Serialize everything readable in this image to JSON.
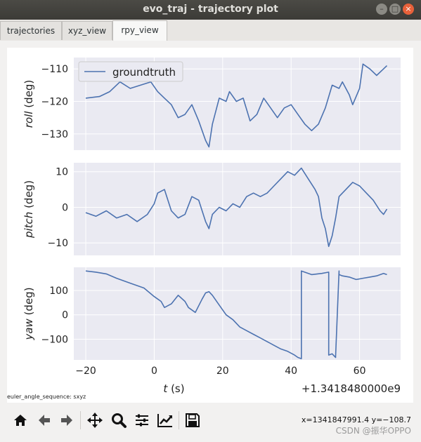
{
  "window": {
    "title": "evo_traj - trajectory plot"
  },
  "tabs": [
    {
      "label": "trajectories"
    },
    {
      "label": "xyz_view"
    },
    {
      "label": "rpy_view"
    }
  ],
  "active_tab": "rpy_view",
  "figure": {
    "footnote": "euler_angle_sequence: sxyz",
    "x_offset_text": "+1.3418480000e9"
  },
  "statusbar": {
    "coords": "x=1341847991.4 y=−108.7",
    "watermark": "CSDN @振华OPPO"
  },
  "toolbar": {
    "icons": [
      "home-icon",
      "back-icon",
      "forward-icon",
      "pan-icon",
      "zoom-icon",
      "configure-subplots-icon",
      "edit-axis-icon",
      "save-icon"
    ]
  },
  "colors": {
    "line": "#4c72b0",
    "axes_bg": "#eaeaf2",
    "grid": "#ffffff"
  },
  "chart_data": [
    {
      "type": "line",
      "ylabel_italic": "roll",
      "ylabel_unit": " (deg)",
      "xlabel": "",
      "legend": {
        "entries": [
          "groundtruth"
        ],
        "placement": "top-left"
      },
      "ylim": [
        -135,
        -106.5
      ],
      "yticks": [
        -130,
        -120,
        -110
      ],
      "ytick_labels": [
        "−130",
        "−120",
        "−110"
      ],
      "xlim": [
        -23.5,
        72
      ],
      "xticks": [
        -20,
        0,
        20,
        40,
        60
      ],
      "grid": true,
      "series": [
        {
          "name": "groundtruth",
          "x": [
            -20,
            -16,
            -13,
            -10,
            -7,
            -4,
            -1,
            1,
            3,
            5,
            7,
            9,
            11,
            13,
            15,
            16,
            17,
            19,
            21,
            22,
            24,
            26,
            28,
            30,
            32,
            34,
            36,
            38,
            40,
            42,
            44,
            46,
            48,
            50,
            52,
            54,
            55,
            57,
            58,
            60,
            61,
            63,
            65,
            67,
            68
          ],
          "y": [
            -119,
            -118.5,
            -117,
            -114,
            -116,
            -115,
            -114,
            -117,
            -119,
            -121,
            -125,
            -124,
            -121,
            -126,
            -132,
            -134,
            -127,
            -119,
            -120,
            -117,
            -120,
            -119,
            -126,
            -124,
            -119,
            -122,
            -125,
            -122,
            -121,
            -124,
            -127,
            -129,
            -127,
            -122,
            -115,
            -116,
            -114,
            -118,
            -121,
            -116,
            -108.5,
            -110,
            -112,
            -110,
            -109
          ]
        }
      ]
    },
    {
      "type": "line",
      "ylabel_italic": "pitch",
      "ylabel_unit": " (deg)",
      "xlabel": "",
      "ylim": [
        -13.5,
        12.5
      ],
      "yticks": [
        -10,
        0,
        10
      ],
      "ytick_labels": [
        "−10",
        "0",
        "10"
      ],
      "xlim": [
        -23.5,
        72
      ],
      "xticks": [
        -20,
        0,
        20,
        40,
        60
      ],
      "grid": true,
      "series": [
        {
          "name": "groundtruth",
          "x": [
            -20,
            -17,
            -14,
            -11,
            -8,
            -5,
            -2,
            0,
            1,
            3,
            5,
            7,
            9,
            11,
            13,
            15,
            16,
            17,
            19,
            21,
            23,
            25,
            27,
            29,
            31,
            33,
            35,
            37,
            39,
            41,
            43,
            45,
            47,
            48,
            49,
            50,
            51,
            52,
            53,
            54,
            56,
            58,
            60,
            62,
            64,
            66,
            67,
            68
          ],
          "y": [
            -1.5,
            -2.5,
            -1,
            -3,
            -2,
            -4,
            -2,
            1,
            4,
            5,
            -1,
            -3,
            -2,
            3,
            2,
            -4,
            -6,
            -2,
            0,
            -1,
            1,
            0,
            3,
            4,
            3,
            4,
            6,
            8,
            10,
            9,
            11,
            8,
            5,
            3,
            -3,
            -6,
            -11,
            -8,
            -3,
            3,
            5,
            7,
            6,
            4,
            2,
            -1,
            -2,
            -0.5
          ]
        }
      ]
    },
    {
      "type": "line",
      "ylabel_italic": "yaw",
      "ylabel_unit": " (deg)",
      "xlabel": "t (s)",
      "ylim": [
        -185,
        195
      ],
      "yticks": [
        -100,
        0,
        100
      ],
      "ytick_labels": [
        "−100",
        "0",
        "100"
      ],
      "xlim": [
        -23.5,
        72
      ],
      "xticks": [
        -20,
        0,
        20,
        40,
        60
      ],
      "xtick_labels": [
        "−20",
        "0",
        "20",
        "40",
        "60"
      ],
      "grid": true,
      "series": [
        {
          "name": "groundtruth",
          "x": [
            -20,
            -17,
            -14,
            -11,
            -7,
            -3,
            0,
            2,
            3,
            5,
            7,
            9,
            10,
            12,
            14,
            15,
            16,
            17,
            19,
            21,
            23,
            25,
            27,
            29,
            31,
            33,
            35,
            37,
            39,
            41,
            42,
            43,
            43,
            46,
            49,
            51,
            51,
            52,
            53,
            53,
            54,
            54,
            55,
            57,
            59,
            61,
            63,
            65,
            67,
            68
          ],
          "y": [
            180,
            175,
            168,
            150,
            130,
            110,
            75,
            55,
            30,
            45,
            80,
            55,
            30,
            10,
            65,
            90,
            95,
            80,
            40,
            0,
            -20,
            -50,
            -65,
            -80,
            -95,
            -110,
            -125,
            -140,
            -150,
            -165,
            -175,
            -180,
            180,
            165,
            170,
            175,
            -165,
            -160,
            -175,
            -170,
            180,
            165,
            160,
            155,
            145,
            150,
            155,
            160,
            170,
            165
          ]
        }
      ]
    }
  ]
}
